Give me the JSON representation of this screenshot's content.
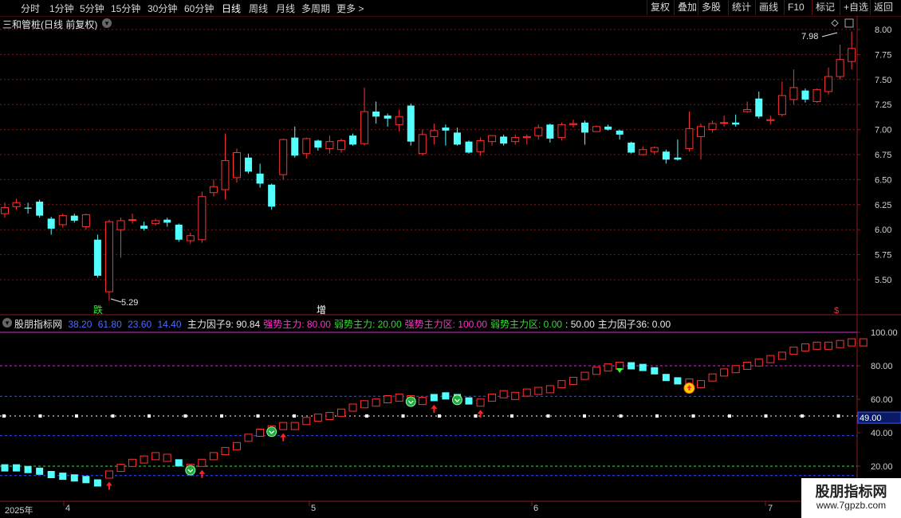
{
  "toolbar": {
    "timeframes": [
      "分时",
      "1分钟",
      "5分钟",
      "15分钟",
      "30分钟",
      "60分钟",
      "日线",
      "周线",
      "月线",
      "多周期",
      "更多"
    ],
    "active_timeframe": "日线",
    "buttons": [
      "复权",
      "叠加",
      "多股",
      "统计",
      "画线",
      "F10",
      "标记",
      "+自选",
      "返回"
    ]
  },
  "main_chart": {
    "title": "三和管桩(日线 前复权)",
    "price_axis": [
      "8.00",
      "7.75",
      "7.50",
      "7.25",
      "7.00",
      "6.75",
      "6.50",
      "6.25",
      "6.00",
      "5.75",
      "5.50"
    ],
    "high_marker": "7.98",
    "low_marker": "5.29",
    "signals": {
      "die": "跌",
      "zeng": "增",
      "dollar": "$"
    }
  },
  "indicator": {
    "name": "股朋指标网",
    "params": [
      "38.20",
      "61.80",
      "23.60",
      "14.40"
    ],
    "values": [
      {
        "label": "主力因子9: 90.84",
        "color": "#e8e8e8"
      },
      {
        "label": "强势主力: 80.00",
        "color": "#ff33cc"
      },
      {
        "label": "弱势主力: 20.00",
        "color": "#33dd33"
      },
      {
        "label": "强势主力区: 100.00",
        "color": "#ff33cc"
      },
      {
        "label": "弱势主力区: 0.00",
        "color": "#33dd33"
      },
      {
        "label": ": 50.00",
        "color": "#e8e8e8"
      },
      {
        "label": "主力因子36: 0.00",
        "color": "#e8e8e8"
      }
    ],
    "axis": [
      "100.00",
      "80.00",
      "60.00",
      "40.00",
      "20.00"
    ],
    "current_value": "49.00"
  },
  "date_axis": [
    "2025年",
    "4",
    "5",
    "6",
    "7"
  ],
  "logo": {
    "title": "股朋指标网",
    "url": "www.7gpzb.com"
  },
  "colors": {
    "up": "#ff3232",
    "down": "#54ffff",
    "bg": "#000000",
    "grid": "#7a1a1a"
  },
  "chart_data": {
    "type": "candlestick",
    "price_ylim": [
      5.29,
      8.05
    ],
    "candles": [
      {
        "o": 6.16,
        "c": 6.22,
        "h": 6.27,
        "l": 6.12
      },
      {
        "o": 6.23,
        "c": 6.27,
        "h": 6.31,
        "l": 6.2
      },
      {
        "o": 6.22,
        "c": 6.21,
        "h": 6.27,
        "l": 6.16
      },
      {
        "o": 6.28,
        "c": 6.14,
        "h": 6.3,
        "l": 6.12
      },
      {
        "o": 6.11,
        "c": 6.01,
        "h": 6.13,
        "l": 5.95
      },
      {
        "o": 6.05,
        "c": 6.14,
        "h": 6.16,
        "l": 6.02
      },
      {
        "o": 6.14,
        "c": 6.09,
        "h": 6.16,
        "l": 6.07
      },
      {
        "o": 6.03,
        "c": 6.15,
        "h": 6.16,
        "l": 6.0
      },
      {
        "o": 5.9,
        "c": 5.54,
        "h": 5.95,
        "l": 5.52
      },
      {
        "o": 5.38,
        "c": 6.08,
        "h": 6.1,
        "l": 5.29
      },
      {
        "o": 6.0,
        "c": 6.09,
        "h": 6.12,
        "l": 5.72
      },
      {
        "o": 6.1,
        "c": 6.1,
        "h": 6.16,
        "l": 6.06
      },
      {
        "o": 6.04,
        "c": 6.01,
        "h": 6.08,
        "l": 5.99
      },
      {
        "o": 6.06,
        "c": 6.09,
        "h": 6.11,
        "l": 6.04
      },
      {
        "o": 6.1,
        "c": 6.07,
        "h": 6.12,
        "l": 6.03
      },
      {
        "o": 6.05,
        "c": 5.9,
        "h": 6.06,
        "l": 5.88
      },
      {
        "o": 5.89,
        "c": 5.94,
        "h": 5.97,
        "l": 5.86
      },
      {
        "o": 5.9,
        "c": 6.33,
        "h": 6.38,
        "l": 5.87
      },
      {
        "o": 6.37,
        "c": 6.43,
        "h": 6.5,
        "l": 6.33
      },
      {
        "o": 6.4,
        "c": 6.69,
        "h": 6.96,
        "l": 6.3
      },
      {
        "o": 6.52,
        "c": 6.77,
        "h": 6.81,
        "l": 6.47
      },
      {
        "o": 6.72,
        "c": 6.58,
        "h": 6.76,
        "l": 6.56
      },
      {
        "o": 6.56,
        "c": 6.46,
        "h": 6.66,
        "l": 6.42
      },
      {
        "o": 6.45,
        "c": 6.23,
        "h": 6.46,
        "l": 6.2
      },
      {
        "o": 6.55,
        "c": 6.9,
        "h": 6.91,
        "l": 6.5
      },
      {
        "o": 6.92,
        "c": 6.74,
        "h": 7.03,
        "l": 6.72
      },
      {
        "o": 6.76,
        "c": 6.91,
        "h": 6.92,
        "l": 6.71
      },
      {
        "o": 6.89,
        "c": 6.82,
        "h": 6.9,
        "l": 6.79
      },
      {
        "o": 6.81,
        "c": 6.88,
        "h": 6.94,
        "l": 6.76
      },
      {
        "o": 6.8,
        "c": 6.89,
        "h": 6.91,
        "l": 6.77
      },
      {
        "o": 6.94,
        "c": 6.85,
        "h": 6.96,
        "l": 6.84
      },
      {
        "o": 6.86,
        "c": 7.18,
        "h": 7.42,
        "l": 6.84
      },
      {
        "o": 7.18,
        "c": 7.13,
        "h": 7.28,
        "l": 7.06
      },
      {
        "o": 7.14,
        "c": 7.11,
        "h": 7.16,
        "l": 7.03
      },
      {
        "o": 7.05,
        "c": 7.13,
        "h": 7.2,
        "l": 6.98
      },
      {
        "o": 7.24,
        "c": 6.88,
        "h": 7.26,
        "l": 6.84
      },
      {
        "o": 6.76,
        "c": 6.95,
        "h": 7.0,
        "l": 6.74
      },
      {
        "o": 6.93,
        "c": 6.99,
        "h": 7.06,
        "l": 6.85
      },
      {
        "o": 7.02,
        "c": 6.99,
        "h": 7.05,
        "l": 6.84
      },
      {
        "o": 6.97,
        "c": 6.85,
        "h": 7.02,
        "l": 6.84
      },
      {
        "o": 6.88,
        "c": 6.77,
        "h": 6.89,
        "l": 6.76
      },
      {
        "o": 6.78,
        "c": 6.89,
        "h": 6.92,
        "l": 6.74
      },
      {
        "o": 6.88,
        "c": 6.94,
        "h": 6.94,
        "l": 6.84
      },
      {
        "o": 6.93,
        "c": 6.86,
        "h": 6.95,
        "l": 6.84
      },
      {
        "o": 6.88,
        "c": 6.92,
        "h": 6.95,
        "l": 6.85
      },
      {
        "o": 6.92,
        "c": 6.93,
        "h": 6.95,
        "l": 6.85
      },
      {
        "o": 6.94,
        "c": 7.02,
        "h": 7.05,
        "l": 6.9
      },
      {
        "o": 7.05,
        "c": 6.91,
        "h": 7.06,
        "l": 6.87
      },
      {
        "o": 6.92,
        "c": 7.05,
        "h": 7.07,
        "l": 6.89
      },
      {
        "o": 7.05,
        "c": 7.06,
        "h": 7.1,
        "l": 7.02
      },
      {
        "o": 7.07,
        "c": 6.97,
        "h": 7.09,
        "l": 6.85
      },
      {
        "o": 6.98,
        "c": 7.03,
        "h": 7.04,
        "l": 6.98
      },
      {
        "o": 7.03,
        "c": 7.0,
        "h": 7.05,
        "l": 6.99
      },
      {
        "o": 6.99,
        "c": 6.95,
        "h": 7.0,
        "l": 6.9
      },
      {
        "o": 6.87,
        "c": 6.77,
        "h": 6.88,
        "l": 6.76
      },
      {
        "o": 6.75,
        "c": 6.8,
        "h": 6.83,
        "l": 6.74
      },
      {
        "o": 6.78,
        "c": 6.82,
        "h": 6.83,
        "l": 6.75
      },
      {
        "o": 6.78,
        "c": 6.7,
        "h": 6.8,
        "l": 6.66
      },
      {
        "o": 6.72,
        "c": 6.7,
        "h": 6.9,
        "l": 6.69
      },
      {
        "o": 6.81,
        "c": 7.01,
        "h": 7.18,
        "l": 6.78
      },
      {
        "o": 6.93,
        "c": 7.03,
        "h": 7.06,
        "l": 6.7
      },
      {
        "o": 7.0,
        "c": 7.06,
        "h": 7.09,
        "l": 6.97
      },
      {
        "o": 7.07,
        "c": 7.07,
        "h": 7.14,
        "l": 7.03
      },
      {
        "o": 7.07,
        "c": 7.05,
        "h": 7.15,
        "l": 7.03
      },
      {
        "o": 7.18,
        "c": 7.2,
        "h": 7.28,
        "l": 7.17
      },
      {
        "o": 7.31,
        "c": 7.13,
        "h": 7.38,
        "l": 7.11
      },
      {
        "o": 7.09,
        "c": 7.1,
        "h": 7.14,
        "l": 7.05
      },
      {
        "o": 7.15,
        "c": 7.34,
        "h": 7.48,
        "l": 7.13
      },
      {
        "o": 7.3,
        "c": 7.42,
        "h": 7.6,
        "l": 7.25
      },
      {
        "o": 7.39,
        "c": 7.3,
        "h": 7.41,
        "l": 7.27
      },
      {
        "o": 7.28,
        "c": 7.4,
        "h": 7.41,
        "l": 7.27
      },
      {
        "o": 7.38,
        "c": 7.53,
        "h": 7.62,
        "l": 7.35
      },
      {
        "o": 7.53,
        "c": 7.7,
        "h": 7.85,
        "l": 7.5
      },
      {
        "o": 7.68,
        "c": 7.81,
        "h": 7.98,
        "l": 7.6
      }
    ],
    "indicator_ylim": [
      12,
      105
    ],
    "indicator_values": [
      19,
      19,
      18,
      17,
      15,
      14,
      13,
      12,
      10,
      15,
      19,
      22,
      24,
      26,
      25,
      22,
      19,
      22,
      26,
      29,
      32,
      37,
      40,
      42,
      44,
      44,
      47,
      49,
      50,
      52,
      55,
      57,
      58,
      60,
      61,
      60,
      59,
      61,
      62,
      61,
      59,
      58,
      61,
      63,
      62,
      64,
      65,
      66,
      69,
      71,
      74,
      77,
      79,
      80,
      80,
      79,
      77,
      73,
      71,
      70,
      69,
      73,
      76,
      78,
      80,
      82,
      84,
      86,
      89,
      91,
      92,
      92,
      93,
      94,
      94
    ],
    "indicator_down": [
      0,
      1,
      2,
      3,
      4,
      5,
      6,
      7,
      8,
      15,
      37,
      38,
      39,
      40,
      54,
      55,
      56,
      57,
      58
    ],
    "ref_lines": [
      100,
      80,
      61.8,
      50,
      38.2,
      20,
      14.4
    ]
  }
}
